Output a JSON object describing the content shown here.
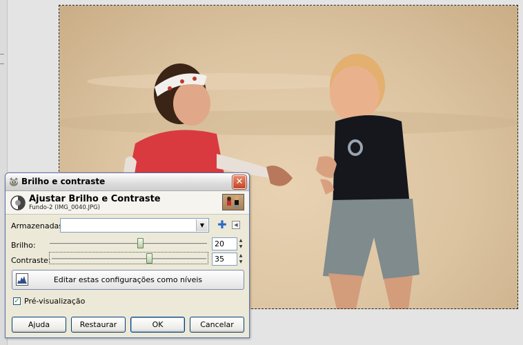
{
  "dialog": {
    "title": "Brilho e contraste",
    "close_glyph": "✕",
    "header_title": "Ajustar Brilho e Contraste",
    "header_subtitle": "Fundo-2 (IMG_0040.JPG)",
    "presets_label": "Armazenadas:",
    "presets_value": "",
    "add_glyph": "✚",
    "brightness_label": "Brilho:",
    "brightness_value": "20",
    "contrast_label": "Contraste:",
    "contrast_value": "35",
    "edit_levels_label": "Editar estas configurações como níveis",
    "preview_label": "Pré-visualização",
    "preview_checked": true,
    "buttons": {
      "help": "Ajuda",
      "reset": "Restaurar",
      "ok": "OK",
      "cancel": "Cancelar"
    }
  },
  "sliders": {
    "brightness": {
      "value": 20,
      "min": -127,
      "max": 127
    },
    "contrast": {
      "value": 35,
      "min": -127,
      "max": 127
    }
  },
  "icons": {
    "title": "gimp-icon",
    "header": "brightness-contrast-icon",
    "add": "plus-icon",
    "menu": "menu-arrow-icon",
    "levels": "levels-icon"
  },
  "colors": {
    "dialog_bg": "#ece9d8",
    "close_button": "#c2462a",
    "check_mark": "#21a121",
    "photo_sand": "#dcc4a1"
  }
}
